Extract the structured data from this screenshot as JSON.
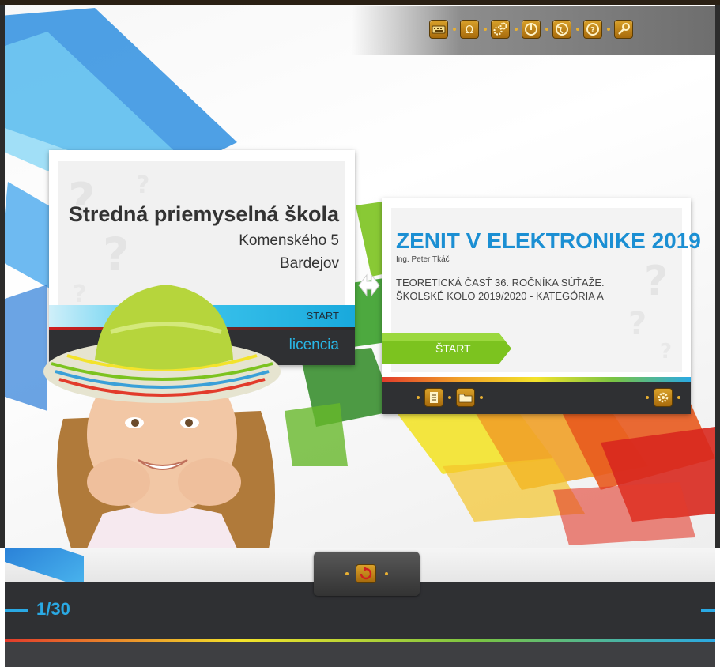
{
  "toolbar": {
    "buttons": [
      {
        "icon": "keyboard-icon"
      },
      {
        "icon": "omega-icon"
      },
      {
        "icon": "gears-icon"
      },
      {
        "icon": "power-icon"
      },
      {
        "icon": "globe-icon"
      },
      {
        "icon": "help-icon"
      },
      {
        "icon": "key-icon"
      }
    ]
  },
  "school": {
    "name": "Stredná priemyselná škola",
    "street": "Komenského 5",
    "city": "Bardejov",
    "start_label": "START",
    "license_label": "licencia"
  },
  "contest": {
    "title": "ZENIT V ELEKTRONIKE 2019",
    "author": "Ing. Peter Tkáč",
    "line1": "TEORETICKÁ ČASŤ 36. ROČNÍKA SÚŤAŽE.",
    "line2": "ŠKOLSKÉ KOLO 2019/2020 - KATEGÓRIA A",
    "start_button": "ŠTART",
    "buttons": [
      {
        "icon": "document-icon"
      },
      {
        "icon": "folder-icon"
      },
      {
        "icon": "settings-icon"
      }
    ]
  },
  "footer": {
    "page_counter": "1/30",
    "center_button_icon": "refresh-icon"
  },
  "colors": {
    "accent_blue": "#2aa9e4",
    "title_blue": "#1b8fd3",
    "start_green": "#7cc31f",
    "dark_bar": "#2f3033",
    "icon_gold": "#c78a1a"
  }
}
